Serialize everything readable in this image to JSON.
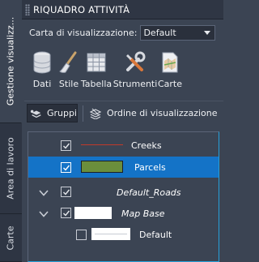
{
  "panel": {
    "title": "RIQUADRO ATTIVITÀ"
  },
  "side_tabs": [
    {
      "label": "Gestione visualizz..."
    },
    {
      "label": "Area di lavoro"
    },
    {
      "label": "Carte"
    }
  ],
  "map_selector": {
    "label": "Carta di visualizzazione:",
    "value": "Default"
  },
  "toolbar": {
    "buttons": [
      {
        "label": "Dati",
        "icon": "database-icon"
      },
      {
        "label": "Stile",
        "icon": "brush-icon"
      },
      {
        "label": "Tabella",
        "icon": "table-grid-icon"
      },
      {
        "label": "Strumenti",
        "icon": "tools-icon"
      },
      {
        "label": "Carte",
        "icon": "map-document-icon"
      }
    ]
  },
  "group_row": {
    "groups_label": "Gruppi",
    "draw_order_label": "Ordine di visualizzazione"
  },
  "layers": [
    {
      "name": "Creeks",
      "checked": true,
      "selected": false,
      "expandable": false,
      "italic": false,
      "swatch": "line",
      "swatch_color": "#c0392b"
    },
    {
      "name": "Parcels",
      "checked": true,
      "selected": true,
      "expandable": false,
      "italic": false,
      "swatch": "fill",
      "swatch_color": "#6b8e3c"
    },
    {
      "name": "Default_Roads",
      "checked": true,
      "selected": false,
      "expandable": true,
      "italic": true,
      "swatch": "none"
    },
    {
      "name": "Map Base",
      "checked": true,
      "selected": false,
      "expandable": true,
      "italic": true,
      "swatch": "white"
    },
    {
      "name": "Default",
      "checked": false,
      "selected": false,
      "expandable": false,
      "italic": false,
      "swatch": "whiteline"
    }
  ],
  "colors": {
    "panel_bg": "#3b4453",
    "selection": "#1473c7",
    "accent_border": "#26a0da"
  }
}
